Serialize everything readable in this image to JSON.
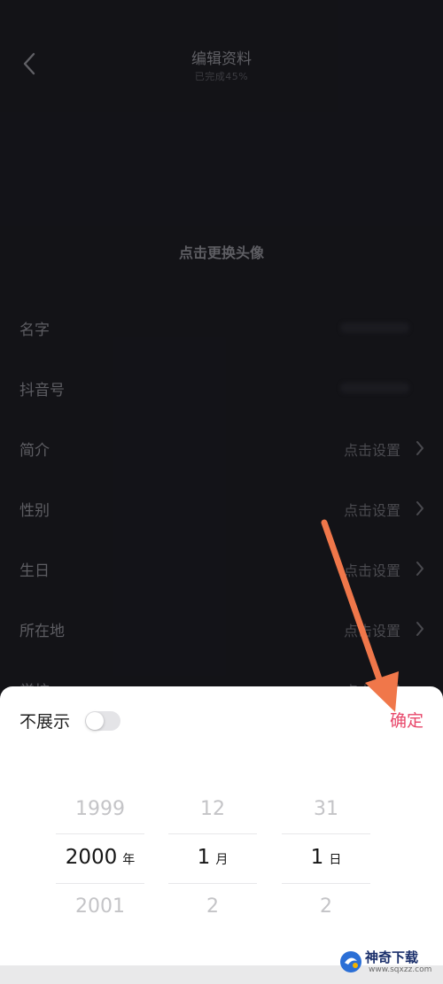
{
  "header": {
    "title": "编辑资料",
    "subtitle": "已完成45%"
  },
  "avatar_hint": "点击更换头像",
  "rows": [
    {
      "label": "名字",
      "value": ""
    },
    {
      "label": "抖音号",
      "value": ""
    },
    {
      "label": "简介",
      "value": "点击设置"
    },
    {
      "label": "性别",
      "value": "点击设置"
    },
    {
      "label": "生日",
      "value": "点击设置"
    },
    {
      "label": "所在地",
      "value": "点击设置"
    },
    {
      "label": "学校",
      "value": "点击设置"
    }
  ],
  "sheet": {
    "hide_label": "不展示",
    "toggle_on": false,
    "confirm_label": "确定",
    "year": {
      "prev": "1999",
      "current": "2000",
      "next": "2001",
      "unit": "年"
    },
    "month": {
      "prev": "12",
      "current": "1",
      "next": "2",
      "unit": "月"
    },
    "day": {
      "prev": "31",
      "current": "1",
      "next": "2",
      "unit": "日"
    }
  },
  "watermark": {
    "name": "神奇下载",
    "url": "www.sqxzz.com"
  },
  "colors": {
    "background": "#16161b",
    "accent": "#e8476a",
    "arrow": "#f0774a"
  }
}
